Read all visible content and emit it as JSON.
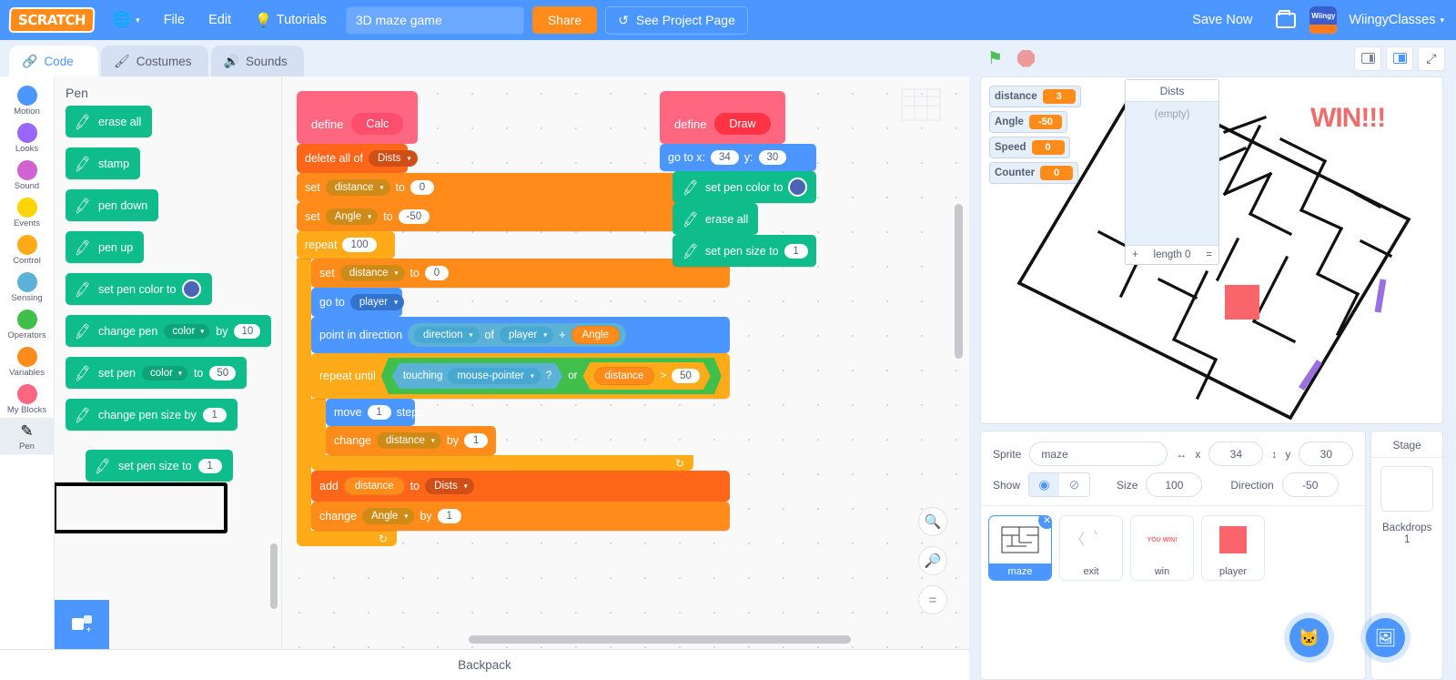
{
  "menubar": {
    "logo": "SCRATCH",
    "globe_icon": "globe-icon",
    "file": "File",
    "edit": "Edit",
    "tutorials": "Tutorials",
    "tutorials_icon": "lightbulb-icon",
    "project_name": "3D maze game",
    "project_name_placeholder": "Project title",
    "share": "Share",
    "see_project_page": "See Project Page",
    "see_project_page_icon": "fork-icon",
    "save_now": "Save Now",
    "folder_icon": "folder-icon",
    "username": "WiingyClasses",
    "avatar_text": "Wiingy",
    "user_caret": "▾"
  },
  "tabs": [
    {
      "label": "Code",
      "icon": "code-icon",
      "active": true
    },
    {
      "label": "Costumes",
      "icon": "brush-icon",
      "active": false
    },
    {
      "label": "Sounds",
      "icon": "speaker-icon",
      "active": false
    }
  ],
  "categories": [
    {
      "label": "Motion",
      "color": "#4c97ff"
    },
    {
      "label": "Looks",
      "color": "#9966ff"
    },
    {
      "label": "Sound",
      "color": "#cf63cf"
    },
    {
      "label": "Events",
      "color": "#ffd500"
    },
    {
      "label": "Control",
      "color": "#ffab19"
    },
    {
      "label": "Sensing",
      "color": "#5cb1d6"
    },
    {
      "label": "Operators",
      "color": "#40bf4a"
    },
    {
      "label": "Variables",
      "color": "#ff8c1a"
    },
    {
      "label": "My Blocks",
      "color": "#ff6680"
    },
    {
      "label": "Pen",
      "color": "#0fbd8c",
      "icon": "pen-icon",
      "selected": true
    }
  ],
  "palette": {
    "title": "Pen",
    "blocks": [
      {
        "label": "erase all"
      },
      {
        "label": "stamp"
      },
      {
        "label": "pen down"
      },
      {
        "label": "pen up"
      },
      {
        "label": "set pen color to",
        "swatch": "#4c63b6"
      },
      {
        "label_a": "change pen",
        "dropdown": "color",
        "label_b": "by",
        "value": "10"
      },
      {
        "label_a": "set pen",
        "dropdown": "color",
        "label_b": "to",
        "value": "50"
      },
      {
        "label": "change pen size by",
        "value": "1"
      },
      {
        "label": "set pen size to",
        "value": "1",
        "highlighted": true
      }
    ],
    "add_extension_icon": "add-extension-icon"
  },
  "scripts": {
    "calc": {
      "define": "define",
      "name": "Calc",
      "delete_all_of": "delete all of",
      "dists": "Dists",
      "set": "set",
      "to": "to",
      "var_distance": "distance",
      "val_zero": "0",
      "var_angle": "Angle",
      "val_neg50": "-50",
      "repeat": "repeat",
      "repeat_count": "100",
      "go_to": "go to",
      "player": "player",
      "point_in_direction": "point in direction",
      "direction": "direction",
      "of": "of",
      "plus": "+",
      "angle_reporter": "Angle",
      "repeat_until": "repeat until",
      "touching": "touching",
      "mouse_pointer": "mouse-pointer",
      "question": "?",
      "or": "or",
      "distance_reporter": "distance",
      "gt": ">",
      "gt_value": "50",
      "move": "move",
      "move_steps": "1",
      "steps": "steps",
      "change": "change",
      "by": "by",
      "change_distance_by": "1",
      "add": "add",
      "add_value": "distance",
      "add_to": "to",
      "change_angle_by": "1"
    },
    "draw": {
      "define": "define",
      "name": "Draw",
      "go_to_x": "go to x:",
      "x": "34",
      "y_label": "y:",
      "y": "30",
      "set_pen_color_to": "set pen color to",
      "pen_color": "#4c63b6",
      "erase_all": "erase all",
      "set_pen_size_to": "set pen size to",
      "pen_size": "1"
    }
  },
  "canvas": {
    "zoom_in_icon": "zoom-in-icon",
    "zoom_out_icon": "zoom-out-icon",
    "zoom_reset_icon": "zoom-reset-icon",
    "minimap_icon": "minimap-icon"
  },
  "backpack": {
    "label": "Backpack"
  },
  "stage_controls": {
    "green_flag_icon": "green-flag-icon",
    "stop_icon": "stop-icon",
    "small_stage_icon": "small-stage-icon",
    "large_stage_icon": "large-stage-icon",
    "fullscreen_icon": "fullscreen-icon"
  },
  "stage": {
    "monitors": [
      {
        "name": "distance",
        "value": "3"
      },
      {
        "name": "Angle",
        "value": "-50"
      },
      {
        "name": "Speed",
        "value": "0"
      },
      {
        "name": "Counter",
        "value": "0"
      }
    ],
    "list_monitor": {
      "title": "Dists",
      "empty_text": "(empty)",
      "length_label": "length 0",
      "add_icon": "+",
      "resize_icon": "="
    },
    "win_text": "WIN!!!",
    "win_color": "#ef6c6c",
    "player_color": "#f9656b",
    "line_color": "#9a6fe0"
  },
  "sprite_info": {
    "sprite_label": "Sprite",
    "sprite_name": "maze",
    "x_label": "x",
    "x_value": "34",
    "y_label": "y",
    "y_value": "30",
    "x_icon": "arrows-horizontal-icon",
    "y_icon": "arrows-vertical-icon",
    "show_label": "Show",
    "show_icon": "eye-icon",
    "hide_icon": "eye-slash-icon",
    "size_label": "Size",
    "size_value": "100",
    "direction_label": "Direction",
    "direction_value": "-50"
  },
  "sprites": [
    {
      "name": "maze",
      "selected": true,
      "thumb": "maze-thumb"
    },
    {
      "name": "exit",
      "selected": false,
      "thumb": "exit-thumb"
    },
    {
      "name": "win",
      "selected": false,
      "thumb": "win-thumb",
      "thumb_text": "YOU WIN!"
    },
    {
      "name": "player",
      "selected": false,
      "thumb": "player-thumb"
    }
  ],
  "stage_panel": {
    "title": "Stage",
    "backdrops_label": "Backdrops",
    "backdrops_count": "1"
  },
  "fabs": {
    "add_sprite_icon": "add-sprite-cat-icon",
    "add_backdrop_icon": "add-backdrop-image-icon"
  }
}
